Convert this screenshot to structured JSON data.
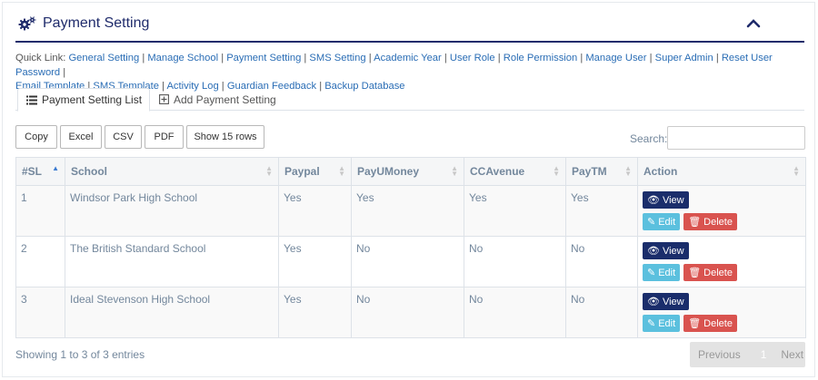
{
  "panel": {
    "title": "Payment Setting"
  },
  "quick_links": {
    "label": "Quick Link:",
    "items": [
      "General Setting",
      "Manage School",
      "Payment Setting",
      "SMS Setting",
      "Academic Year",
      "User Role",
      "Role Permission",
      "Manage User",
      "Super Admin",
      "Reset User Password",
      "Email Template",
      "SMS Template",
      "Activity Log",
      "Guardian Feedback",
      "Backup Database"
    ]
  },
  "tabs": {
    "list": "Payment Setting List",
    "add": "Add Payment Setting"
  },
  "buttons": {
    "copy": "Copy",
    "excel": "Excel",
    "csv": "CSV",
    "pdf": "PDF",
    "show_rows": "Show 15 rows"
  },
  "search": {
    "label": "Search:"
  },
  "table": {
    "headers": [
      "#SL",
      "School",
      "Paypal",
      "PayUMoney",
      "CCAvenue",
      "PayTM",
      "Action"
    ],
    "rows": [
      [
        "1",
        "Windsor Park High School",
        "Yes",
        "Yes",
        "Yes",
        "Yes"
      ],
      [
        "2",
        "The British Standard School",
        "Yes",
        "No",
        "No",
        "No"
      ],
      [
        "3",
        "Ideal Stevenson High School",
        "Yes",
        "No",
        "No",
        "No"
      ]
    ],
    "actions": {
      "view": "View",
      "edit": "Edit",
      "delete": "Delete"
    }
  },
  "footer": {
    "info": "Showing 1 to 3 of 3 entries",
    "previous": "Previous",
    "page": "1",
    "next": "Next"
  },
  "colors": {
    "brand": "#1f2b6b",
    "link": "#2a6db5",
    "view": "#1a2d6b",
    "edit": "#5bc0de",
    "delete": "#d9534f"
  }
}
